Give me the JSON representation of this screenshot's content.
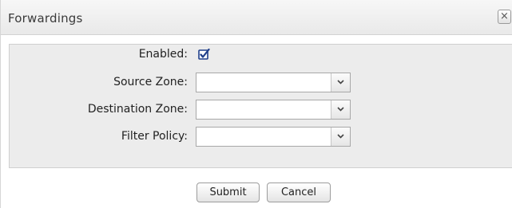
{
  "dialog": {
    "title": "Forwardings",
    "close_glyph": "×",
    "close_icon": "close-icon"
  },
  "form": {
    "enabled": {
      "label": "Enabled:",
      "checked": true
    },
    "source_zone": {
      "label": "Source Zone:",
      "value": ""
    },
    "destination_zone": {
      "label": "Destination Zone:",
      "value": ""
    },
    "filter_policy": {
      "label": "Filter Policy:",
      "value": ""
    }
  },
  "actions": {
    "submit_label": "Submit",
    "cancel_label": "Cancel"
  },
  "colors": {
    "accent_check": "#1f3f8a",
    "panel_bg": "#ececec"
  }
}
